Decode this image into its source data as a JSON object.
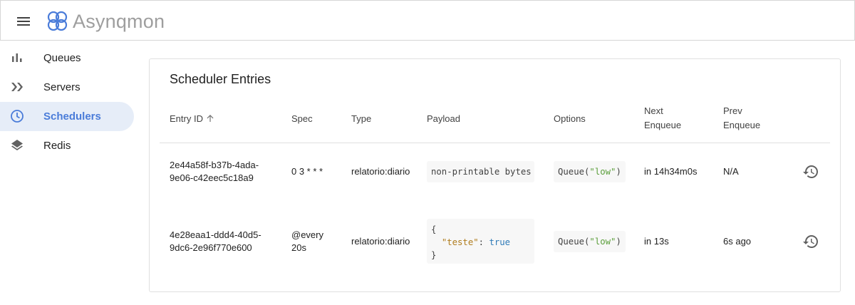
{
  "app": {
    "brand": "Asynqmon"
  },
  "sidebar": {
    "items": [
      {
        "label": "Queues",
        "icon": "bar-chart-icon",
        "active": false
      },
      {
        "label": "Servers",
        "icon": "double-chevron-icon",
        "active": false
      },
      {
        "label": "Schedulers",
        "icon": "clock-icon",
        "active": true
      },
      {
        "label": "Redis",
        "icon": "layers-icon",
        "active": false
      }
    ]
  },
  "card": {
    "title": "Scheduler Entries",
    "columns": {
      "entry_id": "Entry ID",
      "spec": "Spec",
      "type": "Type",
      "payload": "Payload",
      "options": "Options",
      "next_enqueue_1": "Next",
      "next_enqueue_2": "Enqueue",
      "prev_enqueue_1": "Prev",
      "prev_enqueue_2": "Enqueue"
    },
    "rows": [
      {
        "entry_id_1": "2e44a58f-b37b-4ada-",
        "entry_id_2": "9e06-c42eec5c18a9",
        "spec_1": "0 3 * * *",
        "spec_2": "",
        "type": "relatorio:diario",
        "payload": "non-printable bytes",
        "options_prefix": "Queue(",
        "options_value": "\"low\"",
        "options_suffix": ")",
        "next_enqueue": "in 14h34m0s",
        "prev_enqueue": "N/A"
      },
      {
        "entry_id_1": "4e28eaa1-ddd4-40d5-",
        "entry_id_2": "9dc6-2e96f770e600",
        "spec_1": "@every",
        "spec_2": "20s",
        "type": "relatorio:diario",
        "payload_open": "{",
        "payload_key": "\"teste\"",
        "payload_colon": ": ",
        "payload_value": "true",
        "payload_close": "}",
        "options_prefix": "Queue(",
        "options_value": "\"low\"",
        "options_suffix": ")",
        "next_enqueue": "in 13s",
        "prev_enqueue": "6s ago"
      }
    ]
  },
  "colors": {
    "accent": "#4a7cd9",
    "active_bg": "#e6edf8",
    "string": "#5c9f3c",
    "json_key": "#b07d1f",
    "json_bool": "#2f7bb8"
  }
}
